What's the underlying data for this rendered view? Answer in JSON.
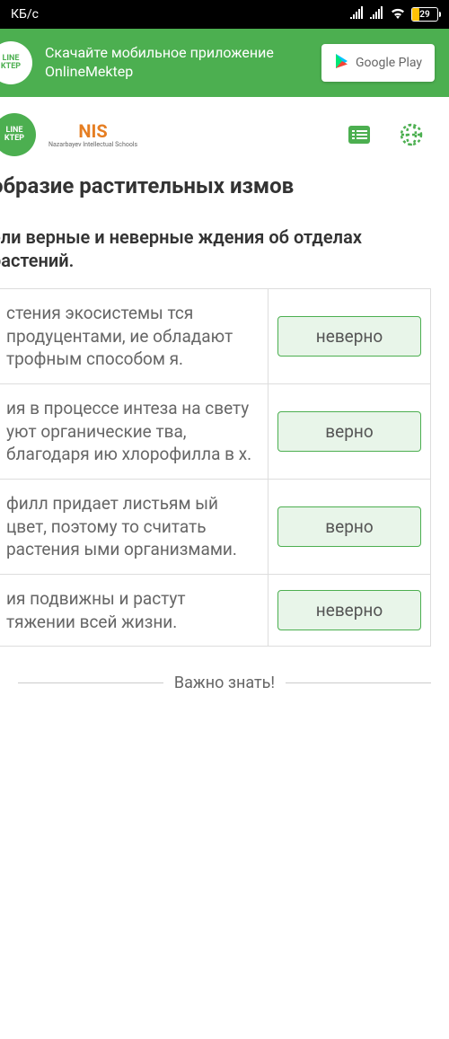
{
  "status": {
    "speed": "КБ/с",
    "battery": "29"
  },
  "banner": {
    "logo_line1": "LINE",
    "logo_line2": "KTEP",
    "text": "Скачайте мобильное приложение OnlineMektep",
    "play_label": "Google Play"
  },
  "header": {
    "logo_line1": "LINE",
    "logo_line2": "KTEP",
    "nis_label": "NIS",
    "nis_sub": "Nazarbayev Intellectual Schools"
  },
  "page": {
    "title": "образие растительных измов",
    "subtitle": "ели верные и неверные ждения об отделах растений."
  },
  "rows": [
    {
      "text": "стения экосистемы тся продуцентами, ие обладают трофным способом я.",
      "answer": "неверно"
    },
    {
      "text": "ия в процессе интеза на свету уют органические тва, благодаря ию хлорофилла в х.",
      "answer": "верно"
    },
    {
      "text": "филл придает листьям ый цвет, поэтому то считать растения ыми организмами.",
      "answer": "верно"
    },
    {
      "text": "ия подвижны и растут тяжении всей жизни.",
      "answer": "неверно"
    }
  ],
  "footer": {
    "label": "Важно знать!"
  }
}
